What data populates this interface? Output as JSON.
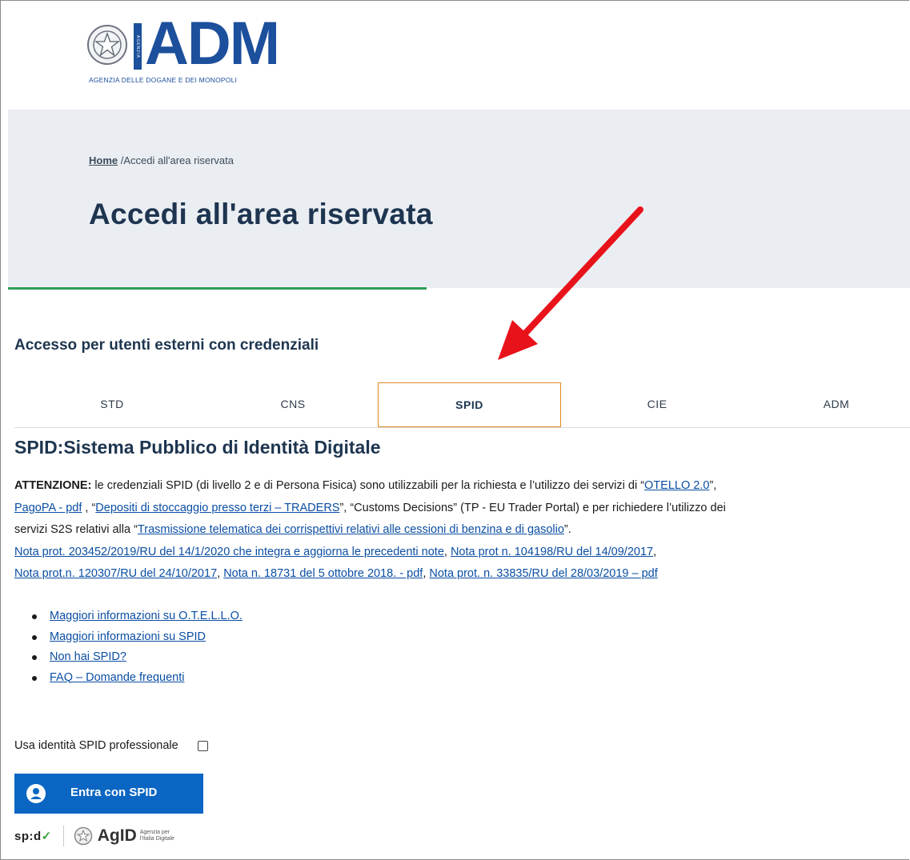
{
  "header": {
    "logo_text": "ADM",
    "logo_vertical": "AGENZIA",
    "logo_subtitle": "AGENZIA DELLE DOGANE E DEI MONOPOLI"
  },
  "breadcrumb": {
    "home": "Home",
    "separator": "/",
    "current": "Accedi all'area riservata"
  },
  "page_title": "Accedi all'area riservata",
  "section_title": "Accesso per utenti esterni con credenziali",
  "tabs": [
    {
      "label": "STD",
      "active": false
    },
    {
      "label": "CNS",
      "active": false
    },
    {
      "label": "SPID",
      "active": true
    },
    {
      "label": "CIE",
      "active": false
    },
    {
      "label": "ADM",
      "active": false
    }
  ],
  "spid": {
    "title": "SPID:Sistema Pubblico di Identità Digitale",
    "attention_label": "ATTENZIONE:",
    "p1_text1": " le credenziali SPID (di livello 2 e di Persona Fisica) sono utilizzabili per la richiesta e l’utilizzo dei servizi di “",
    "link_otello": "OTELLO 2.0",
    "p1_text2": "”,",
    "link_pagopa": "PagoPA - pdf",
    "p2_text1": " , “",
    "link_depositi": "Depositi di stoccaggio presso terzi – TRADERS",
    "p2_text2": "”, “Customs Decisions” (TP - EU Trader Portal) e per richiedere l’utilizzo dei",
    "p3_text1": "servizi S2S relativi alla “",
    "link_trasmissione": "Trasmissione telematica dei corrispettivi relativi alle cessioni di benzina e di gasolio",
    "p3_text2": "”.",
    "link_nota1": "Nota prot. 203452/2019/RU del 14/1/2020 che integra e aggiorna le precedenti note",
    "sep1": ",  ",
    "link_nota2": "Nota prot n. 104198/RU del 14/09/2017",
    "sep2": ",",
    "link_nota3": "Nota prot.n. 120307/RU del 24/10/2017",
    "sep3": ", ",
    "link_nota4": "Nota n. 18731 del 5 ottobre 2018. - pdf",
    "sep4": ", ",
    "link_nota5": "Nota prot. n. 33835/RU del 28/03/2019 – pdf"
  },
  "bullets": [
    "Maggiori informazioni su O.T.E.L.L.O.",
    "Maggiori informazioni su SPID",
    "Non hai SPID?",
    "FAQ – Domande frequenti"
  ],
  "pro_identity_label": "Usa identità SPID professionale",
  "spid_button_label": "Entra con SPID",
  "footer": {
    "spid_logo": "sp:d",
    "agid_word": "AgID",
    "agid_sub_line1": "Agenzia per",
    "agid_sub_line2": "l’Italia Digitale"
  },
  "colors": {
    "brand_blue": "#1c4f9c",
    "button_blue": "#0a66c2",
    "link_blue": "#0b4ea3",
    "active_tab_border": "#e08a1e",
    "accent_green": "#2d9f5a",
    "annotation_arrow": "#e8121b"
  }
}
